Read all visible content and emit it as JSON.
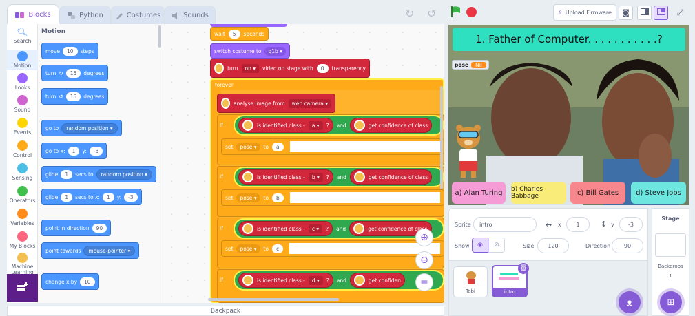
{
  "tabs": {
    "blocks": "Blocks",
    "python": "Python",
    "costumes": "Costumes",
    "sounds": "Sounds"
  },
  "categories": [
    {
      "label": "Search",
      "color": "#4c97ff"
    },
    {
      "label": "Motion",
      "color": "#4c97ff"
    },
    {
      "label": "Looks",
      "color": "#9966ff"
    },
    {
      "label": "Sound",
      "color": "#cf63cf"
    },
    {
      "label": "Events",
      "color": "#ffd500"
    },
    {
      "label": "Control",
      "color": "#ffab19"
    },
    {
      "label": "Sensing",
      "color": "#4cbfe6"
    },
    {
      "label": "Operators",
      "color": "#40bf4a"
    },
    {
      "label": "Variables",
      "color": "#ff8c1a"
    },
    {
      "label": "My Blocks",
      "color": "#ff6680"
    },
    {
      "label": "Machine Learning",
      "color": "#f3c04f"
    }
  ],
  "palette": {
    "title": "Motion",
    "move": {
      "a": "move",
      "v": "10",
      "b": "steps"
    },
    "turn_right": {
      "a": "turn",
      "v": "15",
      "b": "degrees"
    },
    "turn_left": {
      "a": "turn",
      "v": "15",
      "b": "degrees"
    },
    "goto": {
      "a": "go to",
      "d": "random position"
    },
    "gotoxy": {
      "a": "go to x:",
      "x": "1",
      "b": "y:",
      "y": "-3"
    },
    "glide": {
      "a": "glide",
      "v": "1",
      "b": "secs to",
      "d": "random position"
    },
    "glidexy": {
      "a": "glide",
      "v": "1",
      "b": "secs to x:",
      "x": "1",
      "c": "y:",
      "y": "-3"
    },
    "point_dir": {
      "a": "point in direction",
      "v": "90"
    },
    "point_towards": {
      "a": "point towards",
      "d": "mouse-pointer"
    },
    "change_x": {
      "a": "change x by",
      "v": "10"
    }
  },
  "code": {
    "wait": {
      "a": "wait",
      "v": "5",
      "b": "seconds"
    },
    "costume": {
      "a": "switch costume to",
      "d": "q1b"
    },
    "video": {
      "a": "turn",
      "d": "on",
      "b": "video on stage with",
      "v": "0",
      "c": "transparency"
    },
    "forever": "forever",
    "analyse": {
      "a": "analyse image from",
      "d": "web camera"
    },
    "if_rows": [
      {
        "if": "if",
        "a": "is identified class -",
        "cls": "a",
        "q": "?",
        "and": "and",
        "b": "get confidence of class",
        "set": "set",
        "var": "pose",
        "to": "to",
        "val": "a"
      },
      {
        "if": "if",
        "a": "is identified class -",
        "cls": "b",
        "q": "?",
        "and": "and",
        "b": "get confidence of class",
        "set": "set",
        "var": "pose",
        "to": "to",
        "val": "b"
      },
      {
        "if": "if",
        "a": "is identified class -",
        "cls": "c",
        "q": "?",
        "and": "and",
        "b": "get confidence of class",
        "set": "set",
        "var": "pose",
        "to": "to",
        "val": "c"
      },
      {
        "if": "if",
        "a": "is identified class -",
        "cls": "d",
        "q": "?",
        "and": "and",
        "b": "get confiden"
      }
    ]
  },
  "backpack": "Backpack",
  "toolbar": {
    "upload": "Upload Firmware"
  },
  "stage": {
    "question": "1. Father of Computer. . . . . . . . . . .?",
    "monitor_label": "pose",
    "monitor_value": "Nil",
    "answers": [
      {
        "text": "a) Alan Turing",
        "color": "#f59bd6"
      },
      {
        "text": "b) Charles Babbage",
        "color": "#f9ec78"
      },
      {
        "text": "c) Bill Gates",
        "color": "#f7868d"
      },
      {
        "text": "d) Steve Jobs",
        "color": "#6ee6e0"
      }
    ]
  },
  "sprite_info": {
    "sprite_label": "Sprite",
    "sprite_name": "intro",
    "x_label": "x",
    "x_value": "1",
    "y_label": "y",
    "y_value": "-3",
    "show_label": "Show",
    "size_label": "Size",
    "size_value": "120",
    "direction_label": "Direction",
    "direction_value": "90"
  },
  "sprites": [
    {
      "name": "Tobi"
    },
    {
      "name": "intro"
    }
  ],
  "stage_pane": {
    "title": "Stage",
    "backdrops_label": "Backdrops",
    "backdrops_count": "1"
  }
}
